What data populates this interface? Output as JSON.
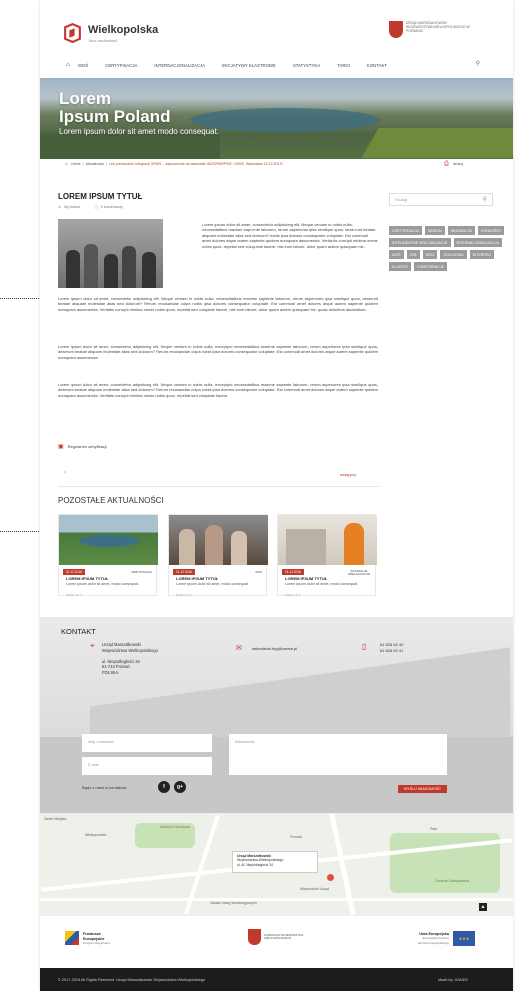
{
  "header": {
    "brand": "Wielkopolska",
    "brand_sub": "Moc możliwości",
    "office_label": "Urząd Marszałkowski Województwa Wielkopolskiego w Poznaniu",
    "nav": [
      "WOŚ",
      "CERTYFIKACJA",
      "INTERNACJONALIZACJA",
      "INICJATYWY KLASTROWE",
      "STATYSTYKA",
      "TARGI",
      "KONTAKT"
    ]
  },
  "hero": {
    "title_line1": "Lorem",
    "title_line2": "Ipsum Poland",
    "subtitle": "Lorem ipsum dolor sit amet modo consequat."
  },
  "breadcrumb": {
    "home": "Home",
    "section": "Aktualności",
    "current": "Lek przewodnik Integracji ORMS – zaproszenie do warsztatu WOŚ/PARP/KE i IOMS. Warszawa 19.12.2017r."
  },
  "print_label": "drukuj",
  "article": {
    "title": "LOREM IPSUM TYTUŁ",
    "author": "By Author",
    "comments": "0 komentarzy",
    "side_text": "Lorem ipsum dolor sit amet, consectetur adipisicing elit. Neque veniam in nobis nulla, necessitatibus maxime sapi-ente laborum, rerum asperiores ipsa similique quos, dese-runt beatae aliquam molestiae alias sed dolorum? nobis ipsa dolores consequatur voluptate. Est commodi amet dolores atque autem sapiente quidem numquam assumenda. Verita-tis corrupti minima omnis nobis quos, repellat sed volup-tate facere, nisi eum labore, dolor quam autem quisquam hic.",
    "paragraphs": [
      "Lorem ipsum dolor sit amet, consectetur adipisicing elit. Neque veniam in nobis nulla, necessitatibus maxime sapiente laborum, rerum asperiores ipsa similique quos, deserunt beatae aliquam molestiae alias sed dolorum? Rerum recusandae culpa nobis ipsa dolores consequatur voluptate. Est commodi amet dolores atque autem sapiente quidem numquam assumenda. Veritatis corrupti minima omnis nobis quos, repellat sed voluptate facere, nisi eum labore, dolor quam autem quisquam hic, quasi doloribus laudantium.",
      "Lorem ipsum dolor sit amet, consectetur adipisicing elit. Neque veniam in nobis nulla, exceptyrd necessitatibus maxime sapiente laborum, rerum asperiores ipsa similique quos, deserunt beatae aliquam molestiae alias sed dolorum? Rerum recusandae culpa nobis ipsa dolores consequatur voluptate. Est commodi amet dolores atque autem sapiente quidem numquam assumenda.",
      "Lorem ipsum dolor sit amet, consectetur adipisicing elit. Neque veniam in nobis nulla, exceptyrd necessitatibus maxime sapiente laborum, rerum asperiores ipsa similique quos, deserunt beatae aliquam molestiae alias sed dolorum? Rerum recusandae culpa nobis ipsa dolores consequatur voluptate. Est commodi amet dolores atque autem sapiente quidem numquam assumenda. Veritatis corrupti minima omnis nobis quos, repellat sed voluptate facere."
    ],
    "regulamin": "Regulamin certyfikacji",
    "prev": "‹",
    "next": "następny"
  },
  "sidebar": {
    "search_placeholder": "Szukaj",
    "tags": [
      "CERTYFIKACJA",
      "DESIGN",
      "INNOWACJE",
      "KONKURSY",
      "INTELIGENTNE SPECJALIZACJE",
      "INTERNACJONALIZACJA",
      "WOŚ",
      "JOB",
      "B2S3",
      "SZKOLENIA",
      "INTERREG",
      "KLASTRY",
      "KONFERENCJE"
    ]
  },
  "other": {
    "title": "POZOSTAŁE AKTUALNOŚCI",
    "cards": [
      {
        "date": "01.12.2016",
        "category": "CERTYFIKACJA",
        "title": "LOREM IPSUM TYTUŁ",
        "text": "Lorem ipsum dolor sit amet, modo consequat.",
        "author": "Autor | ✲ 0"
      },
      {
        "date": "01.12.2016",
        "category": "WOŚ",
        "title": "LOREM IPSUM TYTUŁ",
        "text": "Lorem ipsum dolor sit amet, modo consequat.",
        "author": "Autor | ✲ 0"
      },
      {
        "date": "01.12.2016",
        "category": "INNOWACJE SPECJALIZACJE",
        "title": "LOREM IPSUM TYTUŁ",
        "text": "Lorem ipsum dolor sit amet, modo consequat.",
        "author": "Autor | ✲ 0"
      }
    ]
  },
  "contact": {
    "title": "KONTAKT",
    "address": [
      "Urząd Marszałkowski",
      "Województwa Wielkopolskiego",
      "ul. Niepodległości 34",
      "61-714 Poznań",
      "POLSKA"
    ],
    "email": "sekretariat.drg@umww.pl",
    "phones": [
      "61 626 62 40",
      "61 626 62 41"
    ],
    "name_placeholder": "Imię i nazwisko",
    "email_placeholder": "E-mail",
    "message_placeholder": "Wiadomość",
    "social_label": "Bądź z nami w kontakcie:",
    "send_label": "WYŚLIJ WIADOMOŚĆ"
  },
  "map": {
    "info_lines": [
      "Urząd Marszałkowski",
      "Województwa Wielkopolskiego",
      "ul. Al. Niepodległości 34"
    ],
    "labels": [
      "Zieleń Miejska",
      "Wielkopolskie",
      "Muzeum Narodowe",
      "Park",
      "Centrum Zarządzania",
      "Zakład Usług Wodociągowych",
      "Poznań",
      "Wojewódzki Urząd"
    ]
  },
  "logos": {
    "fe_line1": "Fundusze",
    "fe_line2": "Europejskie",
    "fe_line3": "Program Regionalny",
    "wlk_line1": "Samorząd Województwa",
    "wlk_line2": "Wielkopolskiego",
    "eu_line1": "Unia Europejska",
    "eu_line2": "Europejski Fundusz",
    "eu_line3": "Rozwoju Regionalnego"
  },
  "footer": {
    "copyright": "© 2017-2018 All Rights Reserved. Urząd Marszałkowski Województwa Wielkopolskiego",
    "made_by": "Made by: HANDS"
  },
  "colors": {
    "accent": "#c0392b",
    "tag_bg": "#9b9b9b",
    "footer_bg": "#1c1c1c"
  }
}
